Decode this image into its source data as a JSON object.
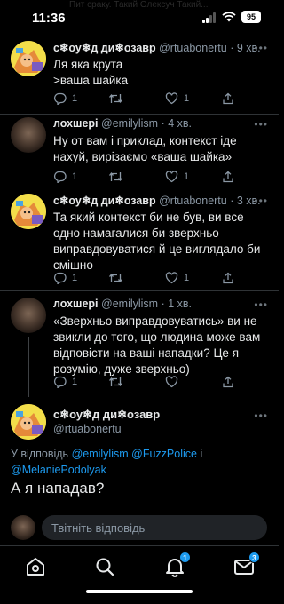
{
  "status_bar": {
    "time": "11:36",
    "battery": "95",
    "faded_background": "Пит сраку. Такий Олексуч Такий..."
  },
  "tweets": [
    {
      "name": "с❄оу❄д ди❄озавр",
      "handle": "@rtuabonertu",
      "time": "· 9 хв.",
      "text": "Ля яка крута\n>ваша шайка",
      "replies": "1",
      "retweets": "",
      "likes": "1"
    },
    {
      "name": "лохшері",
      "handle": "@emilylism",
      "time": "· 4 хв.",
      "text": "Ну от вам і приклад, контекст іде нахуй, вирізаємо «ваша шайка»",
      "replies": "1",
      "retweets": "",
      "likes": "1"
    },
    {
      "name": "с❄оу❄д ди❄озавр",
      "handle": "@rtuabonertu",
      "time": "· 3 хв.",
      "text": "Та який контекст би не був, ви все одно намагалися би зверхньо виправдовуватися й це виглядало би смішно",
      "replies": "1",
      "retweets": "",
      "likes": "1"
    },
    {
      "name": "лохшері",
      "handle": "@emilylism",
      "time": "· 1 хв.",
      "text": "«Зверхньо виправдовуватись» ви не звикли до того, що людина може вам відповісти на ваші нападки? Це я розумію, дуже зверхньо)",
      "replies": "1",
      "retweets": "",
      "likes": ""
    }
  ],
  "focused_tweet": {
    "name": "с❄оу❄д ди❄озавр",
    "handle": "@rtuabonertu",
    "reply_prefix": "У відповідь",
    "mentions": [
      "@emilylism",
      "@FuzzPolice",
      "@MelaniePodolyak"
    ],
    "joiner": "і",
    "text": "А я нападав?"
  },
  "composer": {
    "placeholder": "Твітніть відповідь"
  },
  "tab_bar": {
    "icons": [
      "home-icon",
      "search-icon",
      "notifications-icon",
      "messages-icon"
    ],
    "notifications_badge": "1",
    "messages_badge": "3"
  },
  "colors": {
    "background": "#000000",
    "accent": "#1d9bf0",
    "secondary_text": "#8b98a5",
    "divider": "#2f3336"
  }
}
